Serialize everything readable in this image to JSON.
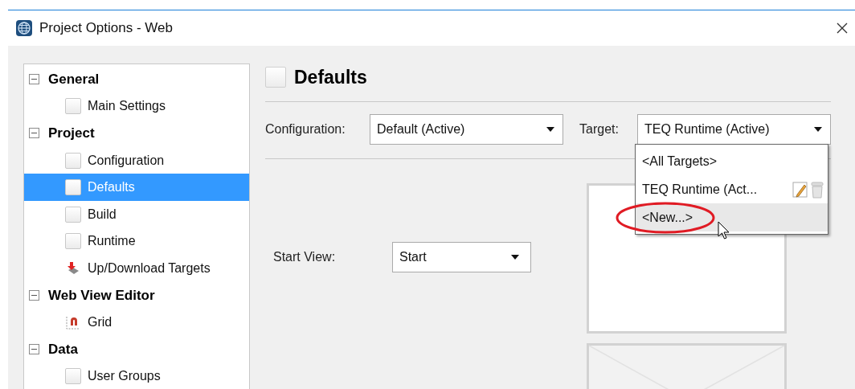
{
  "window": {
    "title": "Project Options - Web"
  },
  "tree": [
    {
      "label": "General",
      "expanded": true,
      "children": [
        {
          "label": "Main Settings",
          "kind": "page",
          "selected": false
        }
      ]
    },
    {
      "label": "Project",
      "expanded": true,
      "children": [
        {
          "label": "Configuration",
          "kind": "page",
          "selected": false
        },
        {
          "label": "Defaults",
          "kind": "page",
          "selected": true
        },
        {
          "label": "Build",
          "kind": "page",
          "selected": false
        },
        {
          "label": "Runtime",
          "kind": "page",
          "selected": false
        },
        {
          "label": "Up/Download Targets",
          "kind": "targets",
          "selected": false
        }
      ]
    },
    {
      "label": "Web View Editor",
      "expanded": true,
      "children": [
        {
          "label": "Grid",
          "kind": "grid",
          "selected": false
        }
      ]
    },
    {
      "label": "Data",
      "expanded": true,
      "children": [
        {
          "label": "User Groups",
          "kind": "page",
          "selected": false
        }
      ]
    }
  ],
  "page": {
    "heading": "Defaults",
    "configuration": {
      "label": "Configuration:",
      "value": "Default (Active)"
    },
    "target": {
      "label": "Target:",
      "value": "TEQ Runtime (Active)",
      "open": true,
      "options": [
        {
          "label": "<All Targets>",
          "kind": "plain",
          "highlighted": false
        },
        {
          "label": "TEQ Runtime (Act...",
          "kind": "editable",
          "highlighted": false
        },
        {
          "label": "<New...>",
          "kind": "plain",
          "highlighted": true,
          "circled": true
        }
      ]
    },
    "start_view": {
      "label": "Start View:",
      "value": "Start"
    }
  }
}
